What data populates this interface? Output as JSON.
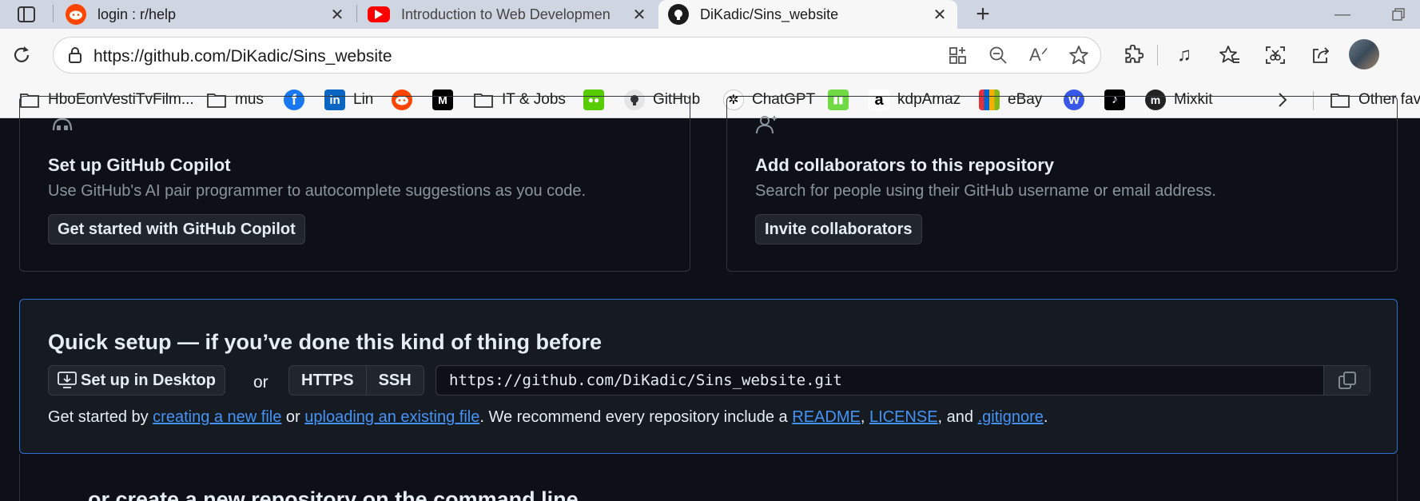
{
  "browser": {
    "tabs": [
      {
        "title": "login : r/help",
        "icon": "reddit-icon",
        "active": false
      },
      {
        "title": "Introduction to Web Developmen",
        "icon": "youtube-icon",
        "active": false
      },
      {
        "title": "DiKadic/Sins_website",
        "icon": "github-icon",
        "active": true
      }
    ],
    "url": "https://github.com/DiKadic/Sins_website",
    "bookmarks": [
      {
        "label": "HboEonVestiTvFilm...",
        "icon": "folder-icon"
      },
      {
        "label": "mus",
        "icon": "folder-icon"
      },
      {
        "label": "",
        "icon": "facebook-icon"
      },
      {
        "label": "Lin",
        "icon": "linkedin-icon"
      },
      {
        "label": "",
        "icon": "reddit-icon"
      },
      {
        "label": "",
        "icon": "medium-icon"
      },
      {
        "label": "IT & Jobs",
        "icon": "folder-icon"
      },
      {
        "label": "",
        "icon": "duolingo-icon"
      },
      {
        "label": "GitHub",
        "icon": "github-icon"
      },
      {
        "label": "ChatGPT",
        "icon": "chatgpt-icon"
      },
      {
        "label": "",
        "icon": "upwork-icon"
      },
      {
        "label": "kdpAmaz",
        "icon": "amazon-icon"
      },
      {
        "label": "eBay",
        "icon": "ebay-icon"
      },
      {
        "label": "",
        "icon": "wordpress-icon"
      },
      {
        "label": "",
        "icon": "tiktok-icon"
      },
      {
        "label": "Mixkit",
        "icon": "mixkit-icon"
      }
    ],
    "other_favorites": "Other fav"
  },
  "copilot": {
    "title": "Set up GitHub Copilot",
    "description": "Use GitHub's AI pair programmer to autocomplete suggestions as you code.",
    "button": "Get started with GitHub Copilot"
  },
  "collaborators": {
    "title": "Add collaborators to this repository",
    "description": "Search for people using their GitHub username or email address.",
    "button": "Invite collaborators"
  },
  "quick_setup": {
    "title": "Quick setup — if you’ve done this kind of thing before",
    "desktop_button": "Set up in Desktop",
    "or": "or",
    "https": "HTTPS",
    "ssh": "SSH",
    "clone_url": "https://github.com/DiKadic/Sins_website.git",
    "get_started_prefix": "Get started by ",
    "link_new_file": "creating a new file",
    "or_text": " or ",
    "link_upload": "uploading an existing file",
    "recommend_text": ". We recommend every repository include a ",
    "link_readme": "README",
    "comma": ", ",
    "link_license": "LICENSE",
    "and_text": ", and ",
    "link_gitignore": ".gitignore",
    "period": "."
  },
  "command_line": {
    "title": "…or create a new repository on the command line"
  },
  "colors": {
    "page_bg": "#0d1117",
    "panel_bg": "#161b22",
    "border": "#30363d",
    "accent_border": "#2f6fd1",
    "link": "#4493f8"
  }
}
